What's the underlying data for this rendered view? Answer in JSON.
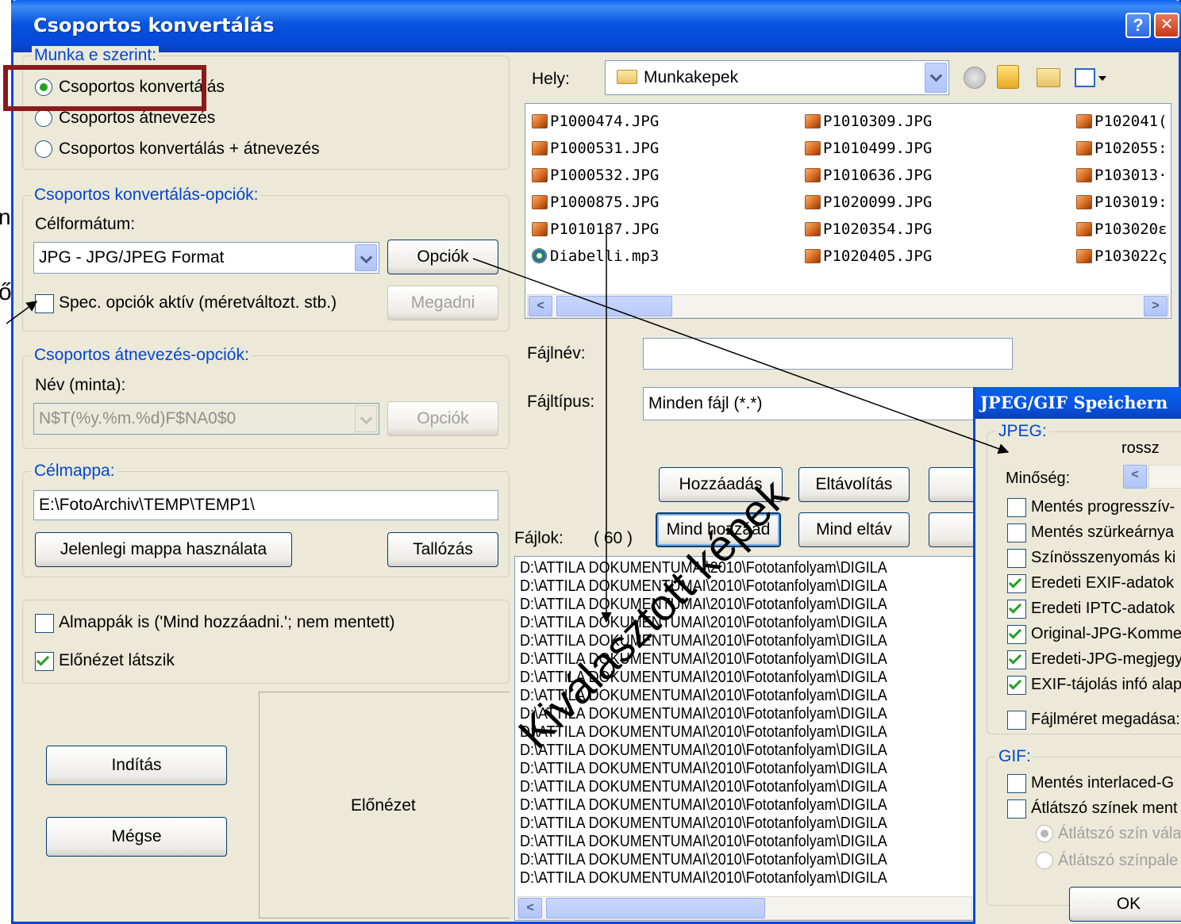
{
  "window": {
    "title": "Csoportos konvertálás",
    "help_label": "?",
    "close_label": "✕"
  },
  "work_group": {
    "title": "Munka e szerint:",
    "options": [
      "Csoportos konvertálás",
      "Csoportos átnevezés",
      "Csoportos konvertálás + átnevezés"
    ],
    "selected": 0
  },
  "convert_options": {
    "title": "Csoportos konvertálás-opciók:",
    "target_format_label": "Célformátum:",
    "format_value": "JPG - JPG/JPEG Format",
    "options_button": "Opciók",
    "spec_checkbox": "Spec. opciók aktív (méretváltozt. stb.)",
    "specify_button": "Megadni"
  },
  "rename_options": {
    "title": "Csoportos átnevezés-opciók:",
    "name_label": "Név (minta):",
    "name_value": "N$T(%y.%m.%d)F$NA0$0",
    "options_button": "Opciók"
  },
  "target_folder": {
    "title": "Célmappa:",
    "path": "E:\\FotoArchiv\\TEMP\\TEMP1\\",
    "use_current_button": "Jelenlegi mappa használata",
    "browse_button": "Tallózás"
  },
  "bottom_options": {
    "subfolders": "Almappák is ('Mind hozzáadni.'; nem mentett)",
    "preview_visible": "Előnézet látszik"
  },
  "actions": {
    "start": "Indítás",
    "cancel": "Mégse"
  },
  "preview_label": "Előnézet",
  "location": {
    "label": "Hely:",
    "folder": "Munkakepek"
  },
  "files_grid": {
    "col1": [
      "P1000474.JPG",
      "P1000531.JPG",
      "P1000532.JPG",
      "P1000875.JPG",
      "P1010187.JPG",
      "Diabelli.mp3"
    ],
    "col2": [
      "P1010309.JPG",
      "P1010499.JPG",
      "P1010636.JPG",
      "P1020099.JPG",
      "P1020354.JPG",
      "P1020405.JPG"
    ],
    "col3": [
      "P102041(",
      "P102055:",
      "P103013·",
      "P103019:",
      "P103020ε",
      "P103022ς"
    ]
  },
  "filename": {
    "label": "Fájlnév:",
    "value": ""
  },
  "filetype": {
    "label": "Fájltípus:",
    "value": "Minden fájl (*.*)"
  },
  "buttons": {
    "add": "Hozzáadás",
    "remove": "Eltávolítás",
    "add_all": "Mind hozzáad",
    "remove_all": "Mind eltáv"
  },
  "files_label": "Fájlok:",
  "files_count": "( 60 )",
  "path_prefix": "D:\\ATTILA DOKUMENTUMAI\\2010\\Fototanfolyam\\DIGILA",
  "sub_dialog": {
    "title": "JPEG/GIF Speichern",
    "jpeg_group": "JPEG:",
    "quality_label": "Minőség:",
    "quality_low": "rossz",
    "jpeg_options": [
      {
        "label": "Mentés progresszív-",
        "checked": false
      },
      {
        "label": "Mentés szürkeárnya",
        "checked": false
      },
      {
        "label": "Színösszenyomás ki",
        "checked": false
      },
      {
        "label": "Eredeti EXIF-adatok",
        "checked": true
      },
      {
        "label": "Eredeti IPTC-adatok",
        "checked": true
      },
      {
        "label": "Original-JPG-Komme",
        "checked": true
      },
      {
        "label": "Eredeti-JPG-megjegy",
        "checked": true
      },
      {
        "label": "EXIF-tájolás infó alap",
        "checked": true
      },
      {
        "label": "Fájlméret megadása:",
        "checked": false
      }
    ],
    "gif_group": "GIF:",
    "gif_options": [
      "Mentés interlaced-G",
      "Átlátszó színek ment"
    ],
    "gif_radios": [
      "Átlátszó szín vála",
      "Átlátszó színpale"
    ],
    "ok": "OK"
  },
  "annotations": {
    "overlay_text": "Kiválasztott képek",
    "edge_left_1": "n",
    "edge_left_2": "ő"
  },
  "colors": {
    "titlebar": "#0854e0",
    "highlight_frame": "#8b1a1a",
    "group_title": "#0046d5",
    "dialog_bg": "#ece9d8"
  }
}
